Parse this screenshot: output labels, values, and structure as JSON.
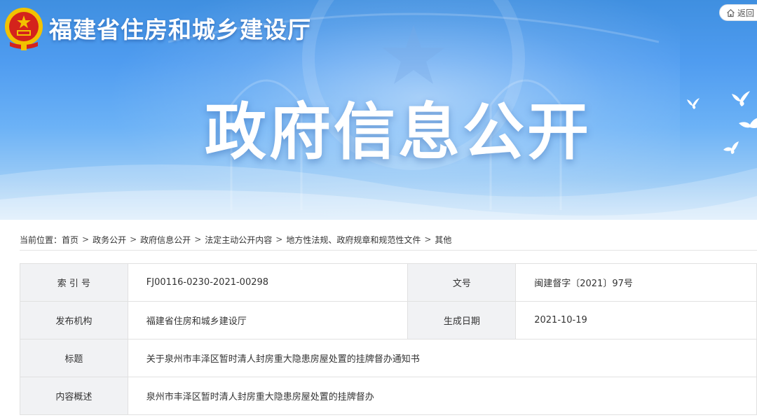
{
  "header": {
    "site_title": "福建省住房和城乡建设厅",
    "back_label": "返回",
    "hero_title": "政府信息公开"
  },
  "breadcrumb": {
    "prefix": "当前位置：",
    "items": [
      "首页",
      "政务公开",
      "政府信息公开",
      "法定主动公开内容",
      "地方性法规、政府规章和规范性文件",
      "其他"
    ],
    "separator": ">"
  },
  "info_table": {
    "rows": [
      {
        "label": "索 引 号",
        "value": "FJ00116-0230-2021-00298",
        "label2": "文号",
        "value2": "闽建督字〔2021〕97号"
      },
      {
        "label": "发布机构",
        "value": "福建省住房和城乡建设厅",
        "label2": "生成日期",
        "value2": "2021-10-19"
      },
      {
        "label": "标题",
        "value": "关于泉州市丰泽区暂时清人封房重大隐患房屋处置的挂牌督办通知书"
      },
      {
        "label": "内容概述",
        "value": "泉州市丰泽区暂时清人封房重大隐患房屋处置的挂牌督办"
      }
    ]
  },
  "colors": {
    "banner_blue": "#4f9cf0",
    "emblem_red": "#d4231c",
    "emblem_gold": "#f2c200",
    "label_bg": "#f1f2f4",
    "border": "#e1e1e1"
  },
  "icons": [
    "national-emblem-icon",
    "home-icon",
    "dove-icon"
  ]
}
